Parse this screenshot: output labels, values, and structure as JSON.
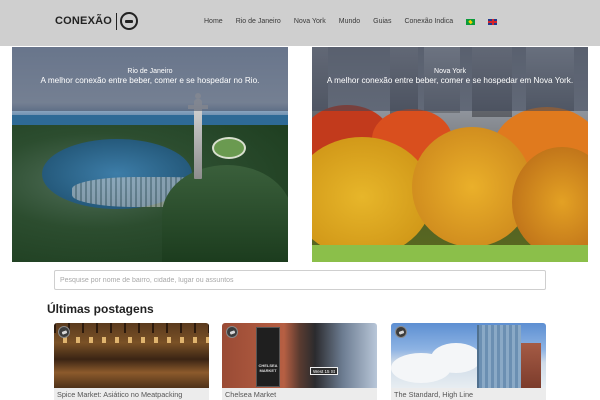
{
  "header": {
    "logo": {
      "text": "CONEXÃO"
    },
    "nav": [
      {
        "label": "Home"
      },
      {
        "label": "Rio de Janeiro"
      },
      {
        "label": "Nova York"
      },
      {
        "label": "Mundo"
      },
      {
        "label": "Guias"
      },
      {
        "label": "Conexão Indica"
      }
    ],
    "languages": [
      {
        "icon": "brazil-flag-icon"
      },
      {
        "icon": "uk-flag-icon"
      }
    ]
  },
  "heroes": [
    {
      "city": "Rio de Janeiro",
      "tagline": "A melhor conexão entre beber, comer e se hospedar no Rio."
    },
    {
      "city": "Nova York",
      "tagline": "A melhor conexão entre beber, comer e se hospedar em Nova York."
    }
  ],
  "search": {
    "placeholder": "Pesquise por nome de bairro, cidade, lugar ou assuntos",
    "value": ""
  },
  "latest": {
    "title": "Últimas postagens",
    "posts": [
      {
        "title": "Spice Market: Asiático no Meatpacking",
        "sign_text": "",
        "street_sign": ""
      },
      {
        "title": "Chelsea Market",
        "sign_text": "CHELSEA MARKET",
        "street_sign": "West 15 St"
      },
      {
        "title": "The Standard, High Line"
      }
    ]
  },
  "colors": {
    "header_bg": "#cfcfcf",
    "hero_overlay": "#3c465a",
    "caption_bg": "#ececec"
  }
}
